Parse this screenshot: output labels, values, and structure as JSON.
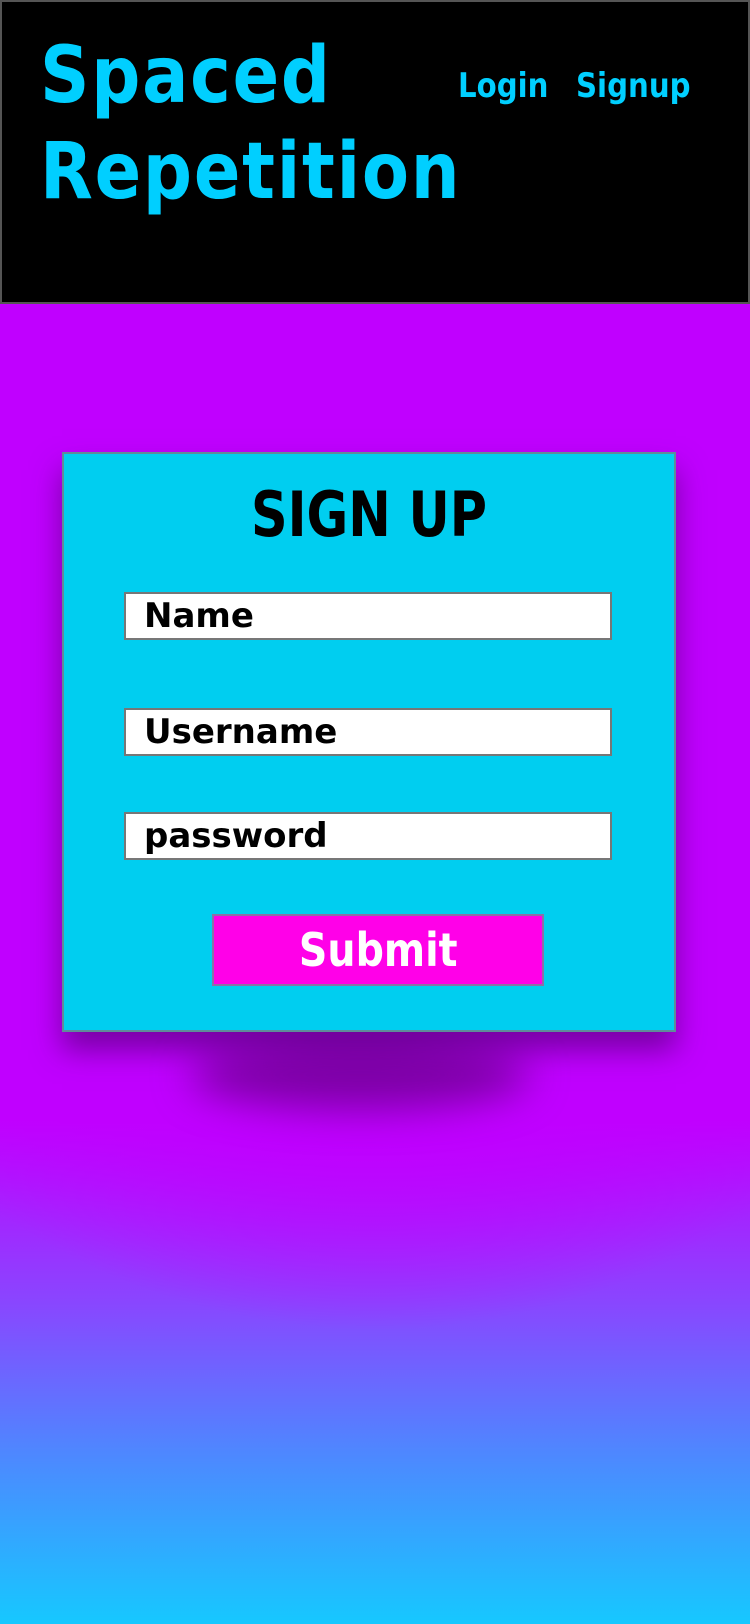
{
  "header": {
    "title": "Spaced Repetition",
    "nav": {
      "login": "Login",
      "signup": "Signup"
    }
  },
  "signup_form": {
    "heading": "SIGN UP",
    "fields": {
      "name_placeholder": "Name",
      "username_placeholder": "Username",
      "password_placeholder": "password"
    },
    "submit_label": "Submit"
  },
  "colors": {
    "accent_cyan": "#00cfff",
    "background_purple": "#c000ff",
    "card_background": "#00cef0",
    "button_magenta": "#ff00e8"
  }
}
